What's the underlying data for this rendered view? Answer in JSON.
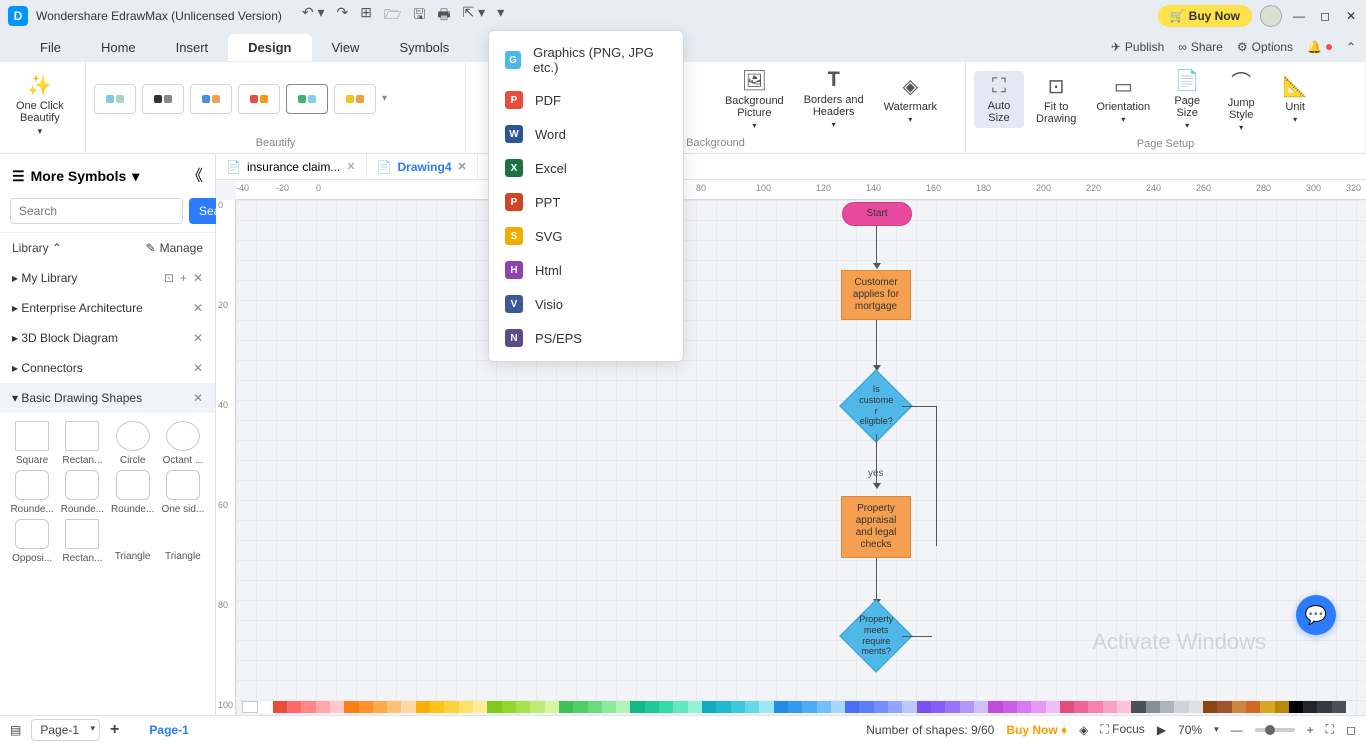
{
  "title": "Wondershare EdrawMax (Unlicensed Version)",
  "buyNow": "Buy Now",
  "menus": [
    "File",
    "Home",
    "Insert",
    "Design",
    "View",
    "Symbols"
  ],
  "activeMenu": "Design",
  "topRight": {
    "publish": "Publish",
    "share": "Share",
    "options": "Options"
  },
  "ribbon": {
    "oneClick": "One Click\nBeautify",
    "beautifyLabel": "Beautify",
    "bgPicture": "Background\nPicture",
    "borders": "Borders and\nHeaders",
    "watermark": "Watermark",
    "backgroundLabel": "Background",
    "autoSize": "Auto\nSize",
    "fitTo": "Fit to\nDrawing",
    "orientation": "Orientation",
    "pageSize": "Page\nSize",
    "jumpStyle": "Jump\nStyle",
    "unit": "Unit",
    "pageSetupLabel": "Page Setup"
  },
  "leftPanel": {
    "header": "More Symbols",
    "searchPlaceholder": "Search",
    "searchBtn": "Search",
    "library": "Library",
    "manage": "Manage",
    "items": [
      "My Library",
      "Enterprise Architecture",
      "3D Block Diagram",
      "Connectors",
      "Basic Drawing Shapes"
    ],
    "shapes": [
      "Square",
      "Rectan...",
      "Circle",
      "Octant ...",
      "Rounde...",
      "Rounde...",
      "Rounde...",
      "One sid...",
      "Opposi...",
      "Rectan...",
      "Triangle",
      "Triangle"
    ]
  },
  "tabs": [
    {
      "name": "insurance claim...",
      "active": false
    },
    {
      "name": "Drawing4",
      "active": true
    }
  ],
  "exportMenu": [
    {
      "label": "Graphics (PNG, JPG etc.)",
      "color": "#4db8e8",
      "letter": "G"
    },
    {
      "label": "PDF",
      "color": "#e74c3c",
      "letter": "P"
    },
    {
      "label": "Word",
      "color": "#2b5797",
      "letter": "W"
    },
    {
      "label": "Excel",
      "color": "#1e7145",
      "letter": "X"
    },
    {
      "label": "PPT",
      "color": "#d04525",
      "letter": "P"
    },
    {
      "label": "SVG",
      "color": "#f0ad00",
      "letter": "S"
    },
    {
      "label": "Html",
      "color": "#8e44ad",
      "letter": "H"
    },
    {
      "label": "Visio",
      "color": "#3b5998",
      "letter": "V"
    },
    {
      "label": "PS/EPS",
      "color": "#5b4b8a",
      "letter": "N"
    }
  ],
  "flowchart": {
    "start": "Start",
    "process1": "Customer\napplies for\nmortgage",
    "decision1": "Is\ncustome\nr\neligible?",
    "yes": "yes",
    "process2": "Property\nappraisal\nand legal\nchecks",
    "decision2": "Property\nmeets\nrequire\nments?"
  },
  "rulerH": [
    "-40",
    "-20",
    "0",
    "80",
    "100",
    "120",
    "140",
    "160",
    "180",
    "200",
    "220",
    "240",
    "260",
    "280",
    "300",
    "320"
  ],
  "rulerV": [
    "0",
    "20",
    "40",
    "60",
    "80",
    "100"
  ],
  "statusbar": {
    "page": "Page-1",
    "pageTab": "Page-1",
    "shapes": "Number of shapes: 9/60",
    "buyNow": "Buy Now",
    "focus": "Focus",
    "zoom": "70%"
  },
  "watermarkText": "Activate Windows",
  "colors": [
    "#ffffff",
    "#e74c3c",
    "#ff6b6b",
    "#ff8787",
    "#ffa8a8",
    "#ffc9c9",
    "#fd7e14",
    "#ff922b",
    "#ffa94d",
    "#ffc078",
    "#ffd8a8",
    "#fab005",
    "#fcc419",
    "#ffd43b",
    "#ffe066",
    "#ffec99",
    "#82c91e",
    "#94d82d",
    "#a9e34b",
    "#c0eb75",
    "#d8f5a2",
    "#40c057",
    "#51cf66",
    "#69db7c",
    "#8ce99a",
    "#b2f2bb",
    "#12b886",
    "#20c997",
    "#38d9a9",
    "#63e6be",
    "#96f2d7",
    "#15aabf",
    "#22b8cf",
    "#3bc9db",
    "#66d9e8",
    "#99e9f2",
    "#228be6",
    "#339af0",
    "#4dabf7",
    "#74c0fc",
    "#a5d8ff",
    "#4c6ef5",
    "#5c7cfa",
    "#748ffc",
    "#91a7ff",
    "#bac8ff",
    "#7950f2",
    "#845ef7",
    "#9775fa",
    "#b197fc",
    "#d0bfff",
    "#be4bdb",
    "#cc5de8",
    "#da77f2",
    "#e599f7",
    "#eebefa",
    "#e64980",
    "#f06595",
    "#f783ac",
    "#faa2c1",
    "#fcc2d7",
    "#495057",
    "#868e96",
    "#adb5bd",
    "#ced4da",
    "#dee2e6",
    "#8b4513",
    "#a0522d",
    "#cd853f",
    "#d2691e",
    "#daa520",
    "#b8860b",
    "#000000",
    "#212529",
    "#343a40",
    "#495057"
  ]
}
